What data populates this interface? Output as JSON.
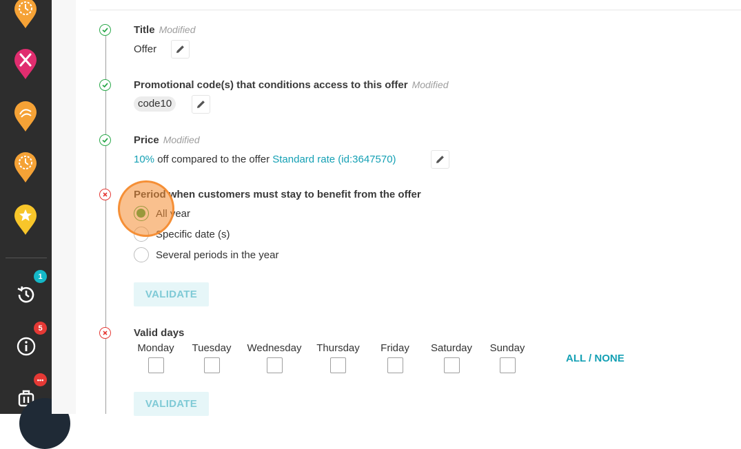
{
  "colors": {
    "sidebar": "#2d2d2d",
    "success": "#2aa84a",
    "error": "#e53935",
    "accent": "#14a0b4",
    "pin_orange": "#f5a236",
    "pin_pink": "#e02d6f",
    "pin_yellow": "#f8c62a"
  },
  "sidebar": {
    "pins": [
      {
        "icon": "clock-icon",
        "color": "#f5a236"
      },
      {
        "icon": "restaurant-icon",
        "color": "#e02d6f"
      },
      {
        "icon": "spa-icon",
        "color": "#f5a236"
      },
      {
        "icon": "clock-icon",
        "color": "#f5a236"
      },
      {
        "icon": "star-icon",
        "color": "#f8c62a"
      }
    ],
    "history_badge": "1",
    "info_badge": "5",
    "luggage_badge": "•••"
  },
  "steps": {
    "title": {
      "label": "Title",
      "status": "Modified",
      "value": "Offer"
    },
    "promo": {
      "label": "Promotional code(s) that conditions access to this offer",
      "status": "Modified",
      "code": "code10"
    },
    "price": {
      "label": "Price",
      "status": "Modified",
      "percent": "10%",
      "text": " off compared to the offer ",
      "link": "Standard rate (id:3647570)"
    },
    "period": {
      "label": "Period when customers must stay to benefit from the offer",
      "options": [
        "All year",
        "Specific date (s)",
        "Several periods in the year"
      ],
      "selected": "All year",
      "validate": "VALIDATE"
    },
    "days": {
      "label": "Valid days",
      "names": [
        "Monday",
        "Tuesday",
        "Wednesday",
        "Thursday",
        "Friday",
        "Saturday",
        "Sunday"
      ],
      "all_none": "ALL / NONE",
      "validate": "VALIDATE"
    }
  }
}
